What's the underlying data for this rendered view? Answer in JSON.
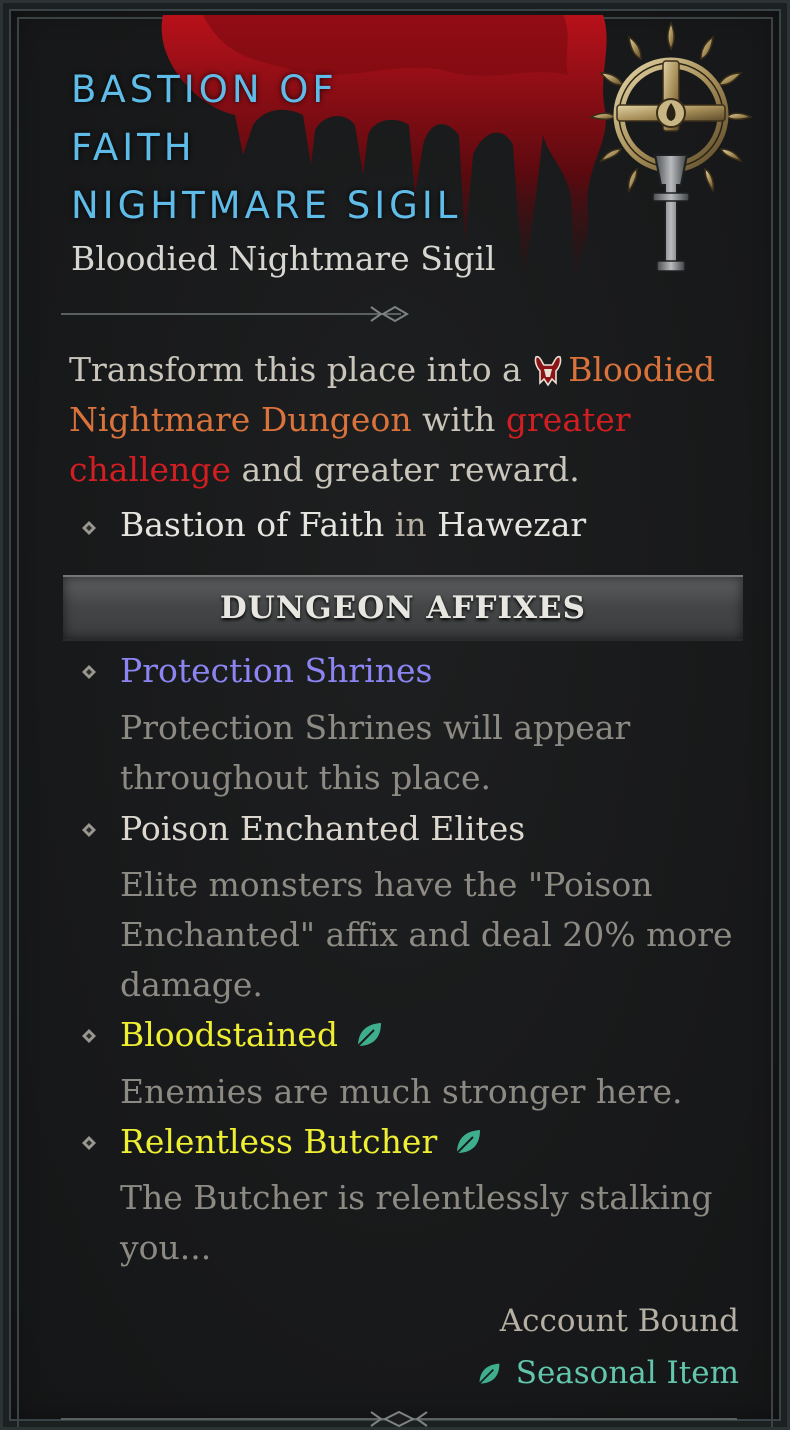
{
  "item": {
    "name_lines": [
      "Bastion of",
      "Faith",
      "Nightmare Sigil"
    ],
    "type": "Bloodied Nightmare Sigil",
    "sigil_icon": "nightmare-sigil-icon"
  },
  "description": {
    "part1": "Transform this place into a",
    "dungeon_icon": "bloodied-nightmare-icon",
    "dungeon_type": "Bloodied Nightmare Dungeon",
    "part2": "with",
    "challenge": "greater challenge",
    "part3": "and greater reward."
  },
  "location": {
    "dungeon": "Bastion of Faith",
    "connector": "in",
    "region": "Hawezar"
  },
  "affixes_header": "DUNGEON AFFIXES",
  "affixes": [
    {
      "name": "Protection Shrines",
      "description": "Protection Shrines will appear throughout this place.",
      "color": "#8b84f2"
    },
    {
      "name": "Poison Enchanted Elites",
      "description": "Elite monsters have the \"Poison Enchanted\" affix and deal 20% more damage.",
      "color": "#dcd8d0"
    },
    {
      "name": "Bloodstained",
      "description": "Enemies are much stronger here.",
      "color": "#eeee32",
      "icon": "seasonal-leaf-icon"
    },
    {
      "name": "Relentless Butcher",
      "description": "The Butcher is relentlessly stalking you...",
      "color": "#eeee32",
      "icon": "seasonal-leaf-icon"
    }
  ],
  "footer": {
    "bound": "Account Bound",
    "seasonal": "Seasonal Item",
    "seasonal_icon": "seasonal-leaf-icon"
  },
  "colors": {
    "title": "#5fbce9",
    "dungeon_type": "#d9733b",
    "challenge": "#d01e22",
    "seasonal": "#62c6ad"
  }
}
